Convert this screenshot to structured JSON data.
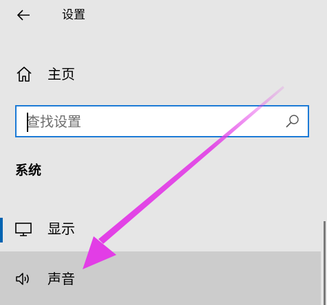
{
  "header": {
    "back_icon": "back-arrow-icon",
    "title": "设置"
  },
  "home": {
    "icon": "home-icon",
    "label": "主页"
  },
  "search": {
    "placeholder": "查找设置",
    "value": "",
    "icon": "search-icon"
  },
  "section": {
    "title": "系统"
  },
  "nav": {
    "items": [
      {
        "label": "显示",
        "icon": "monitor-icon",
        "selected": true
      },
      {
        "label": "声音",
        "icon": "speaker-icon",
        "hovered": true
      }
    ]
  },
  "colors": {
    "accent": "#0063b1",
    "search_border": "#1b7ad6",
    "annotation_arrow": "#e23de6",
    "background": "#e6e6e6",
    "hover": "#cccccc"
  }
}
